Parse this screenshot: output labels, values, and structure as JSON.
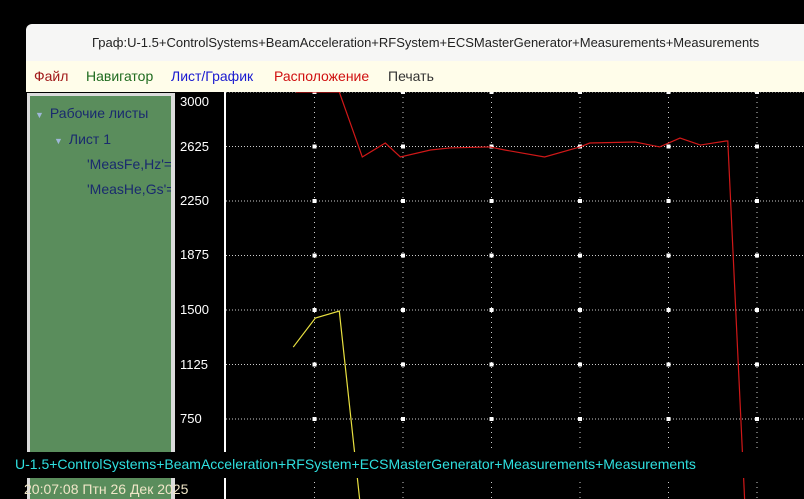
{
  "window": {
    "title": "Граф:U-1.5+ControlSystems+BeamAcceleration+RFSystem+ECSMasterGenerator+Measurements+Measurements"
  },
  "menu": [
    {
      "label": "Файл",
      "color": "#a01818"
    },
    {
      "label": "Навигатор",
      "color": "#1f6b1f"
    },
    {
      "label": "Лист/График",
      "color": "#1a1ad0"
    },
    {
      "label": "Расположение",
      "color": "#d01010"
    },
    {
      "label": "Печать",
      "color": "#333333"
    }
  ],
  "tree": {
    "root": "Рабочие листы",
    "sheet": "Лист 1",
    "items": [
      "'MeasFe,Hz'=",
      "'MeasHe,Gs'="
    ]
  },
  "status": {
    "path": "U-1.5+ControlSystems+BeamAcceleration+RFSystem+ECSMasterGenerator+Measurements+Measurements",
    "clock": "20:07:08 Птн 26 Дек 2025"
  },
  "chart_data": {
    "type": "line",
    "yticks": [
      "3000",
      "2625",
      "2250",
      "1875",
      "1500",
      "1125",
      "750"
    ],
    "ylim": [
      400,
      3000
    ],
    "xlim": [
      0,
      6.5
    ],
    "grid": true,
    "series": [
      {
        "color": "#d01818",
        "x": [
          0.79,
          1.28,
          1.54,
          1.8,
          1.97,
          2.31,
          2.53,
          2.98,
          3.15,
          3.6,
          4.0,
          4.11,
          4.62,
          4.9,
          5.13,
          5.36,
          5.65,
          5.67,
          5.86
        ],
        "values": [
          3000,
          3000,
          2553,
          2649,
          2553,
          2601,
          2615,
          2622,
          2601,
          2553,
          2622,
          2649,
          2656,
          2622,
          2683,
          2635,
          2663,
          2663,
          199
        ]
      },
      {
        "color": "#e8e040",
        "x": [
          0.76,
          1.01,
          1.28,
          1.51
        ],
        "values": [
          1245,
          1445,
          1493,
          199
        ]
      }
    ]
  }
}
